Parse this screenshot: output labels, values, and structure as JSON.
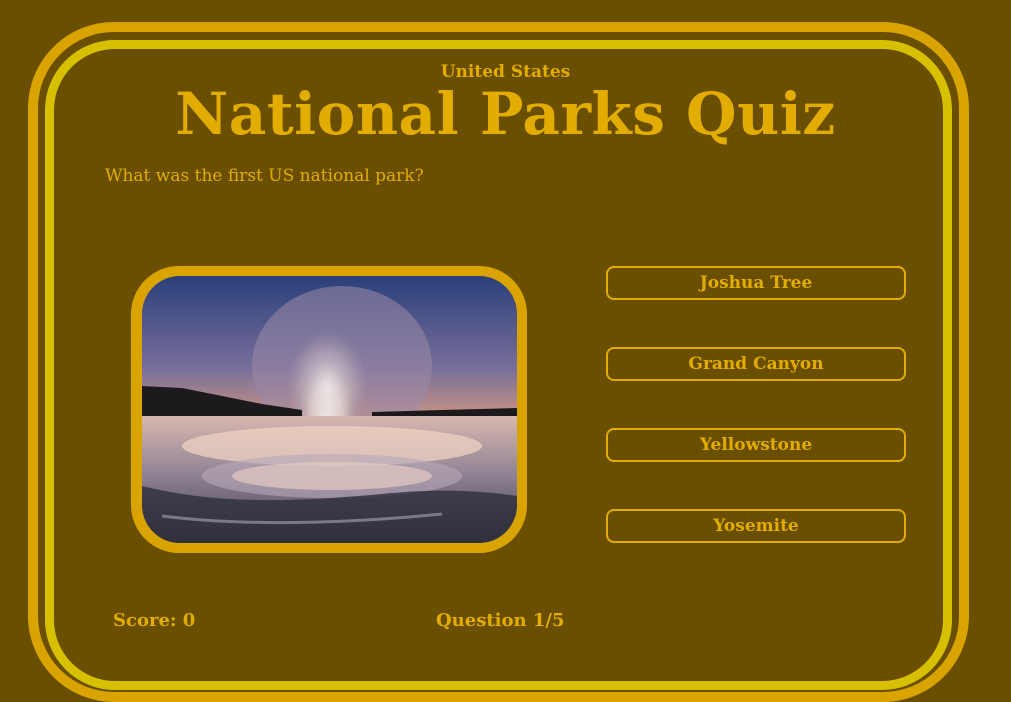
{
  "quiz": {
    "subtitle": "United States",
    "title": "National Parks Quiz",
    "question": "What was the first US national park?",
    "image_alt": "Geyser erupting at sunset",
    "answers": [
      {
        "label": "Joshua Tree"
      },
      {
        "label": "Grand Canyon"
      },
      {
        "label": "Yellowstone"
      },
      {
        "label": "Yosemite"
      }
    ],
    "score_label": "Score: 0",
    "progress_label": "Question 1/5"
  },
  "colors": {
    "background": "#6b4f00",
    "outer_border": "#d9a400",
    "inner_border": "#d6c000",
    "text": "#e2ad00"
  }
}
